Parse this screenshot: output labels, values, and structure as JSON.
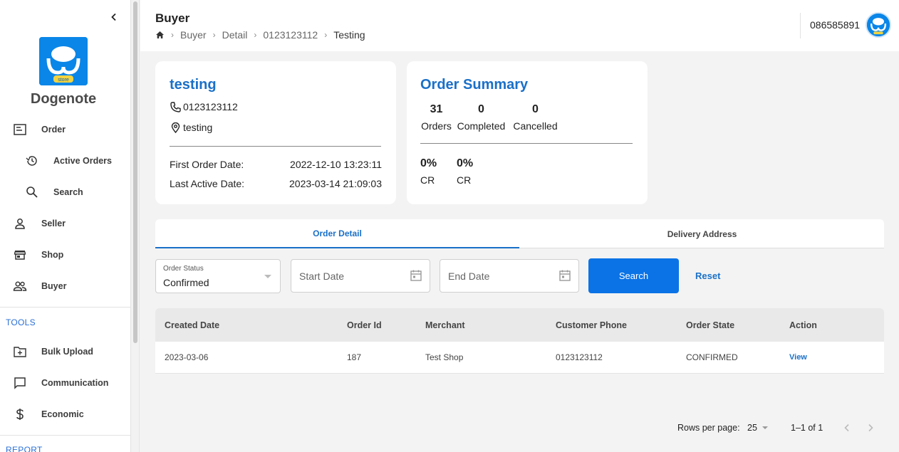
{
  "sidebar": {
    "brand": "Dogenote",
    "logo_text": "store",
    "items": [
      {
        "label": "Order",
        "icon": "list-icon"
      },
      {
        "label": "Active Orders",
        "icon": "history-icon"
      },
      {
        "label": "Search",
        "icon": "search-icon"
      },
      {
        "label": "Seller",
        "icon": "person-icon"
      },
      {
        "label": "Shop",
        "icon": "storefront-icon"
      },
      {
        "label": "Buyer",
        "icon": "people-icon"
      }
    ],
    "tools_label": "TOOLS",
    "tools": [
      {
        "label": "Bulk Upload",
        "icon": "folder-add-icon"
      },
      {
        "label": "Communication",
        "icon": "chat-icon"
      },
      {
        "label": "Economic",
        "icon": "dollar-icon"
      }
    ],
    "report_label": "REPORT"
  },
  "header": {
    "title": "Buyer",
    "breadcrumb": [
      "Buyer",
      "Detail",
      "0123123112",
      "Testing"
    ],
    "user_phone": "086585891"
  },
  "buyer": {
    "name": "testing",
    "phone": "0123123112",
    "location": "testing",
    "first_order_label": "First Order Date:",
    "first_order_value": "2022-12-10 13:23:11",
    "last_active_label": "Last Active Date:",
    "last_active_value": "2023-03-14 21:09:03"
  },
  "summary": {
    "title": "Order Summary",
    "orders_num": "31",
    "orders_label": "Orders",
    "completed_num": "0",
    "completed_label": "Completed",
    "cancelled_num": "0",
    "cancelled_label": "Cancelled",
    "cr1_num": "0%",
    "cr1_label": "CR",
    "cr2_num": "0%",
    "cr2_label": "CR"
  },
  "tabs": {
    "order_detail": "Order Detail",
    "delivery_address": "Delivery Address"
  },
  "filters": {
    "status_label": "Order Status",
    "status_value": "Confirmed",
    "start_placeholder": "Start Date",
    "end_placeholder": "End Date",
    "search_label": "Search",
    "reset_label": "Reset"
  },
  "table": {
    "headers": [
      "Created Date",
      "Order Id",
      "Merchant",
      "Customer Phone",
      "Order State",
      "Action"
    ],
    "rows": [
      {
        "created": "2023-03-06",
        "order_id": "187",
        "merchant": "Test Shop",
        "phone": "0123123112",
        "state": "CONFIRMED",
        "action": "View"
      }
    ]
  },
  "pagination": {
    "rows_label": "Rows per page:",
    "rows_value": "25",
    "range": "1–1 of 1"
  },
  "colors": {
    "accent": "#1a70c8",
    "button": "#0b73e6",
    "brand_blue": "#0a86e8"
  }
}
